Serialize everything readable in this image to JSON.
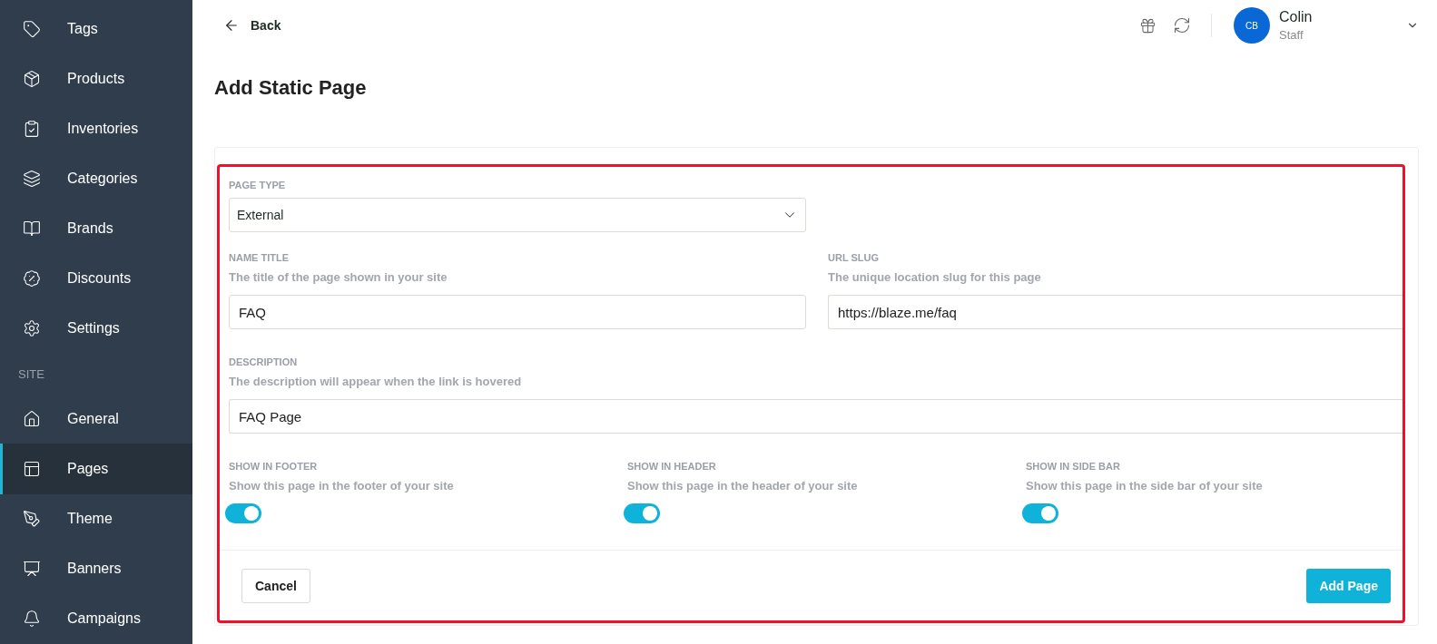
{
  "sidebar": {
    "items": [
      {
        "kind": "item",
        "label": "Tags",
        "selected": false
      },
      {
        "kind": "item",
        "label": "Products",
        "selected": false
      },
      {
        "kind": "item",
        "label": "Inventories",
        "selected": false
      },
      {
        "kind": "item",
        "label": "Categories",
        "selected": false
      },
      {
        "kind": "item",
        "label": "Brands",
        "selected": false
      },
      {
        "kind": "item",
        "label": "Discounts",
        "selected": false
      },
      {
        "kind": "item",
        "label": "Settings",
        "selected": false
      },
      {
        "kind": "section",
        "label": "SITE"
      },
      {
        "kind": "item",
        "label": "General",
        "selected": false
      },
      {
        "kind": "item",
        "label": "Pages",
        "selected": true
      },
      {
        "kind": "item",
        "label": "Theme",
        "selected": false
      },
      {
        "kind": "item",
        "label": "Banners",
        "selected": false
      },
      {
        "kind": "item",
        "label": "Campaigns",
        "selected": false
      }
    ]
  },
  "header": {
    "back": "Back",
    "user": {
      "initials": "CB",
      "name": "Colin",
      "role": "Staff"
    }
  },
  "page_title": "Add Static Page",
  "form": {
    "page_type": {
      "label": "PAGE TYPE",
      "value": "External"
    },
    "name_title": {
      "label": "NAME TITLE",
      "hint": "The title of the page shown in your site",
      "value": "FAQ"
    },
    "url_slug": {
      "label": "URL SLUG",
      "hint": "The unique location slug for this page",
      "value": "https://blaze.me/faq"
    },
    "description": {
      "label": "DESCRIPTION",
      "hint": "The description will appear when the link is hovered",
      "value": "FAQ Page"
    },
    "toggles": [
      {
        "label": "SHOW IN FOOTER",
        "hint": "Show this page in the footer of your site",
        "on": true
      },
      {
        "label": "SHOW IN HEADER",
        "hint": "Show this page in the header of your site",
        "on": true
      },
      {
        "label": "SHOW IN SIDE BAR",
        "hint": "Show this page in the side bar of your site",
        "on": true
      }
    ],
    "cancel": "Cancel",
    "submit": "Add Page"
  }
}
